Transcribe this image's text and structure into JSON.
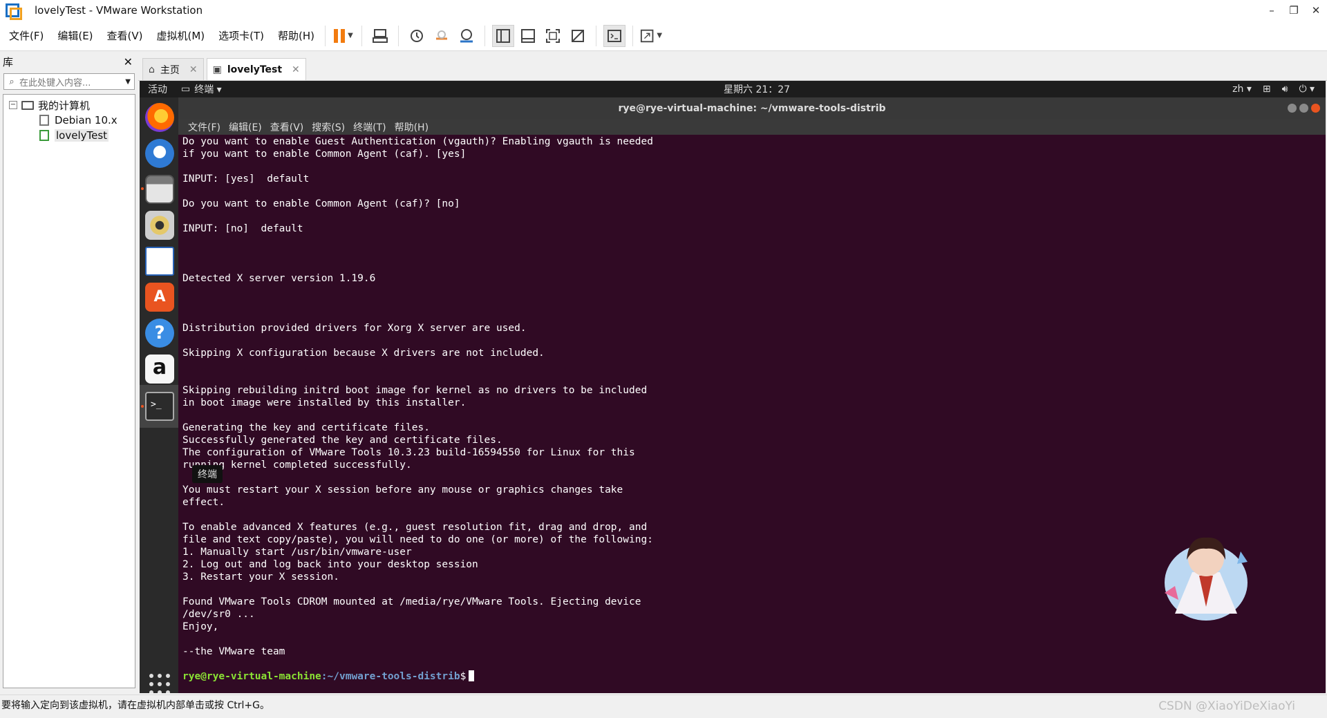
{
  "window": {
    "title": "lovelyTest - VMware Workstation",
    "controls": [
      "–",
      "❐",
      "✕"
    ]
  },
  "menubar": {
    "items": [
      "文件(F)",
      "编辑(E)",
      "查看(V)",
      "虚拟机(M)",
      "选项卡(T)",
      "帮助(H)"
    ],
    "toolbar_icons": [
      "pause-icon",
      "send-keys-icon",
      "snapshot-icon",
      "revert-snapshot-icon",
      "manage-snapshots-icon",
      "library-view-icon",
      "thumbnail-view-icon",
      "fullscreen-icon",
      "unity-icon",
      "console-icon",
      "stretch-icon"
    ],
    "accent": "#f27b0f"
  },
  "library": {
    "title": "库",
    "close": "✕",
    "search_placeholder": "在此处键入内容...",
    "tree": {
      "root": "我的计算机",
      "vms": [
        "Debian 10.x",
        "lovelyTest"
      ]
    }
  },
  "tabs": [
    {
      "label": "主页",
      "icon": "home-icon"
    },
    {
      "label": "lovelyTest",
      "icon": "vm-icon",
      "active": true
    }
  ],
  "guest": {
    "topbar": {
      "activities": "活动",
      "app_menu": "终端 ▾",
      "clock": "星期六 21：27",
      "lang": "zh ▾"
    },
    "dock_tooltip": "终端",
    "terminal": {
      "title": "rye@rye-virtual-machine: ~/vmware-tools-distrib",
      "menu": [
        "文件(F)",
        "编辑(E)",
        "查看(V)",
        "搜索(S)",
        "终端(T)",
        "帮助(H)"
      ],
      "lines": [
        "Do you want to enable Guest Authentication (vgauth)? Enabling vgauth is needed",
        "if you want to enable Common Agent (caf). [yes]",
        "",
        "INPUT: [yes]  default",
        "",
        "Do you want to enable Common Agent (caf)? [no]",
        "",
        "INPUT: [no]  default",
        "",
        "",
        "",
        "Detected X server version 1.19.6",
        "",
        "",
        "",
        "Distribution provided drivers for Xorg X server are used.",
        "",
        "Skipping X configuration because X drivers are not included.",
        "",
        "",
        "Skipping rebuilding initrd boot image for kernel as no drivers to be included",
        "in boot image were installed by this installer.",
        "",
        "Generating the key and certificate files.",
        "Successfully generated the key and certificate files.",
        "The configuration of VMware Tools 10.3.23 build-16594550 for Linux for this",
        "running kernel completed successfully.",
        "",
        "You must restart your X session before any mouse or graphics changes take",
        "effect.",
        "",
        "To enable advanced X features (e.g., guest resolution fit, drag and drop, and",
        "file and text copy/paste), you will need to do one (or more) of the following:",
        "1. Manually start /usr/bin/vmware-user",
        "2. Log out and log back into your desktop session",
        "3. Restart your X session.",
        "",
        "Found VMware Tools CDROM mounted at /media/rye/VMware Tools. Ejecting device",
        "/dev/sr0 ...",
        "Enjoy,",
        "",
        "--the VMware team",
        ""
      ],
      "prompt_user": "rye@rye-virtual-machine",
      "prompt_path": ":~/vmware-tools-distrib",
      "prompt_symbol": "$"
    },
    "colors": {
      "terminal_bg": "#300a24",
      "prompt_user": "#8ae234",
      "prompt_path": "#729fcf",
      "ubuntu_orange": "#e95420"
    }
  },
  "statusbar": {
    "text": "要将输入定向到该虚拟机，请在虚拟机内部单击或按 Ctrl+G。",
    "watermark": "CSDN @XiaoYiDeXiaoYi"
  }
}
